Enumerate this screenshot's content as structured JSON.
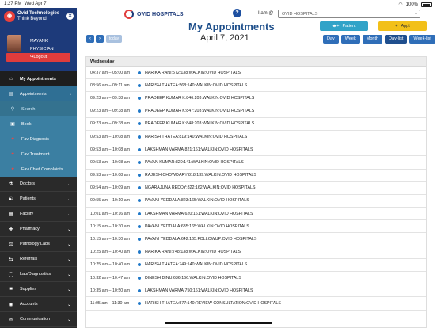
{
  "status": {
    "time": "1:27 PM",
    "date": "Wed Apr 7",
    "battery": "100%"
  },
  "sidebar": {
    "logo_title": "Ovid Technologies",
    "logo_sub": "Think Beyond",
    "user_name": "MAYANK",
    "user_role": "PHYSICIAN",
    "logout": "Logout",
    "menu": [
      {
        "label": "My Appointments",
        "icon": "home-icon"
      },
      {
        "label": "Appointments",
        "icon": "calendar-icon"
      }
    ],
    "submenu": [
      {
        "label": "Search",
        "icon": "search-icon"
      },
      {
        "label": "Book",
        "icon": "book-icon"
      },
      {
        "label": "Fav Diagnosis",
        "icon": "heart-icon"
      },
      {
        "label": "Fav Treatment",
        "icon": "heart-icon"
      },
      {
        "label": "Fav Chief Complaints",
        "icon": "heart-icon"
      }
    ],
    "groups": [
      {
        "label": "Doctors",
        "icon": "doctor-icon"
      },
      {
        "label": "Patients",
        "icon": "patients-icon"
      },
      {
        "label": "Facility",
        "icon": "facility-icon"
      },
      {
        "label": "Pharmacy",
        "icon": "pharmacy-icon"
      },
      {
        "label": "Pathology Labs",
        "icon": "lab-icon"
      },
      {
        "label": "Referrals",
        "icon": "referral-icon"
      },
      {
        "label": "Lab/Diagnostics",
        "icon": "flask-icon"
      },
      {
        "label": "Supplies",
        "icon": "supplies-icon"
      },
      {
        "label": "Accounts",
        "icon": "accounts-icon"
      },
      {
        "label": "Communication",
        "icon": "chat-icon"
      }
    ]
  },
  "header": {
    "brand": "OVID HOSPITALS",
    "i_am": "I am @",
    "hospital": "OVID HOSPITALS",
    "title": "My Appointments",
    "patient_btn": "Patient",
    "appt_btn": "Appt",
    "today": "today",
    "date": "April 7, 2021",
    "views": [
      "Day",
      "Week",
      "Month",
      "Day-list",
      "Week-list"
    ],
    "active_view": "Day-list"
  },
  "calendar": {
    "day_header": "Wednesday",
    "rows": [
      {
        "time": "04:37 am – 05:00 am",
        "desc": "HARIKA RANI:572:138:WALKIN:OVID HOSPITALS"
      },
      {
        "time": "08:56 am – 09:11 am",
        "desc": "HARISH THATEA:568:140:WALKIN:OVID HOSPITALS"
      },
      {
        "time": "09:23 am – 09:38 am",
        "desc": "PRADEEP KUMAR K:846:203:WALKIN:OVID HOSPITALS"
      },
      {
        "time": "09:23 am – 09:38 am",
        "desc": "PRADEEP KUMAR K:847:203:WALKIN:OVID HOSPITALS"
      },
      {
        "time": "09:23 am – 09:38 am",
        "desc": "PRADEEP KUMAR K:848:203:WALKIN:OVID HOSPITALS"
      },
      {
        "time": "09:53 am – 10:08 am",
        "desc": "HARISH THATEA:819:140:WALKIN:OVID HOSPITALS"
      },
      {
        "time": "09:53 am – 10:08 am",
        "desc": "LAKSHMAN VARMA:821:161:WALKIN:OVID HOSPITALS"
      },
      {
        "time": "09:53 am – 10:08 am",
        "desc": "PAVAN KUMAR:820:141:WALKIN:OVID HOSPITALS"
      },
      {
        "time": "09:53 am – 10:08 am",
        "desc": "RAJESH CHOWDARY:818:139:WALKIN:OVID HOSPITALS"
      },
      {
        "time": "09:54 am – 10:09 am",
        "desc": "NGARAJUNA REDDY:822:162:WALKIN:OVID HOSPITALS"
      },
      {
        "time": "09:55 am – 10:10 am",
        "desc": "PAVANI YEDDALA:823:165:WALKIN:OVID HOSPITALS"
      },
      {
        "time": "10:01 am – 10:16 am",
        "desc": "LAKSHMAN VARMA:620:161:WALKIN:OVID HOSPITALS"
      },
      {
        "time": "10:15 am – 10:30 am",
        "desc": "PAVANI YEDDALA:635:165:WALKIN:OVID HOSPITALS"
      },
      {
        "time": "10:15 am – 10:30 am",
        "desc": "PAVANI YEDDALA:642:165:FOLLOWUP:OVID HOSPITALS"
      },
      {
        "time": "10:25 am – 10:40 am",
        "desc": "HARIKA RANI:748:138:WALKIN:OVID HOSPITALS"
      },
      {
        "time": "10:25 am – 10:40 am",
        "desc": "HARISH THATEA:749:140:WALKIN:OVID HOSPITALS"
      },
      {
        "time": "10:32 am – 10:47 am",
        "desc": "DINESH DINU:636:166:WALKIN:OVID HOSPITALS"
      },
      {
        "time": "10:35 am – 10:50 am",
        "desc": "LAKSHMAN VARMA:750:161:WALKIN:OVID HOSPITALS"
      },
      {
        "time": "11:05 am – 11:30 am",
        "desc": "HARISH THATEA:577:140:REVIEW CONSULTATION:OVID HOSPITALS"
      }
    ]
  }
}
